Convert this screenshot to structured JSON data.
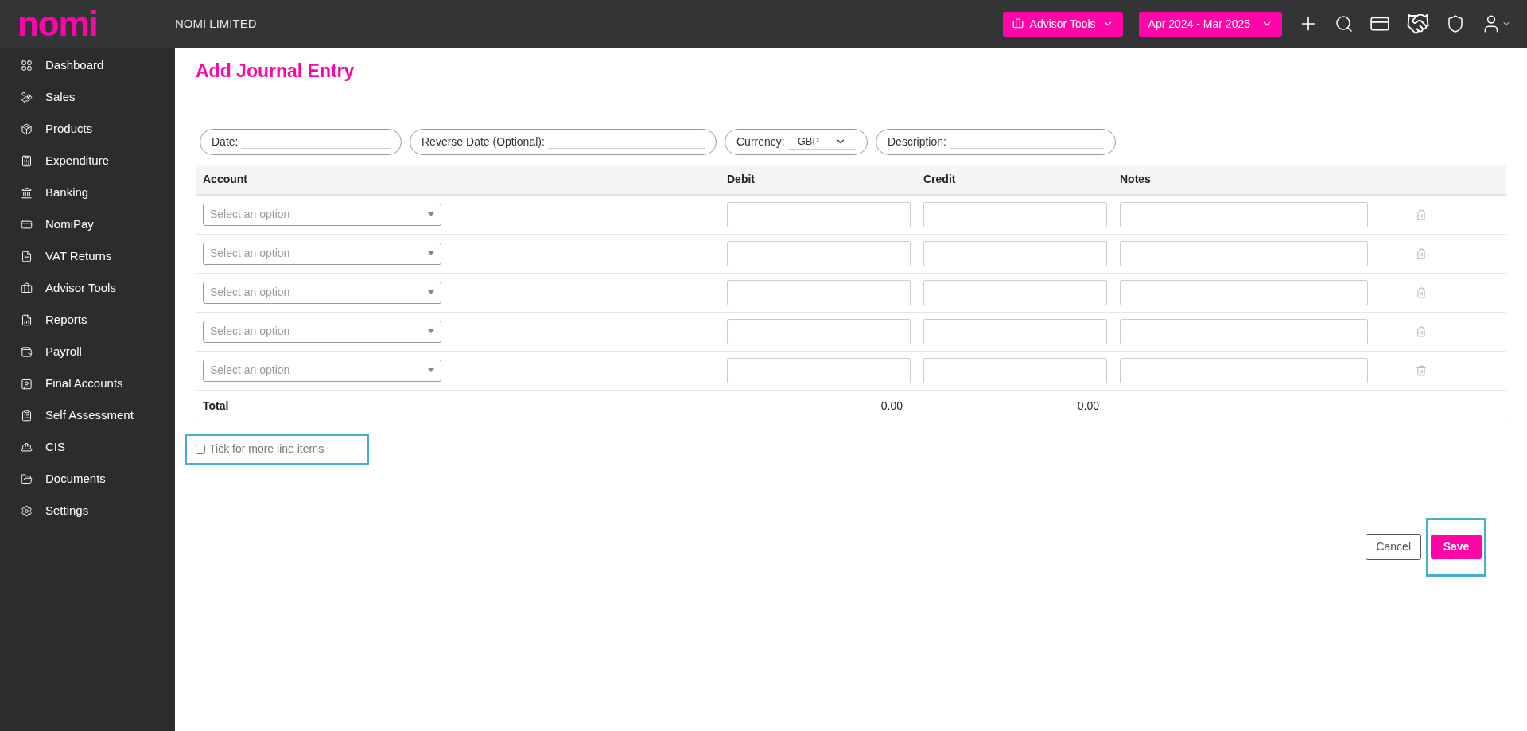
{
  "logo": "nomi",
  "company": "NOMI LIMITED",
  "topbar": {
    "advisor_button": "Advisor Tools",
    "period": "Apr 2024 - Mar 2025"
  },
  "sidebar": {
    "items": [
      {
        "label": "Dashboard"
      },
      {
        "label": "Sales"
      },
      {
        "label": "Products"
      },
      {
        "label": "Expenditure"
      },
      {
        "label": "Banking"
      },
      {
        "label": "NomiPay"
      },
      {
        "label": "VAT Returns"
      },
      {
        "label": "Advisor Tools"
      },
      {
        "label": "Reports"
      },
      {
        "label": "Payroll"
      },
      {
        "label": "Final Accounts"
      },
      {
        "label": "Self Assessment"
      },
      {
        "label": "CIS"
      },
      {
        "label": "Documents"
      },
      {
        "label": "Settings"
      }
    ]
  },
  "page_title": "Add Journal Entry",
  "fields": [
    {
      "kind": "text",
      "label": "Date:"
    },
    {
      "kind": "text",
      "label": "Reverse Date (Optional):"
    },
    {
      "kind": "select",
      "label": "Currency:",
      "value": "GBP"
    },
    {
      "kind": "text",
      "label": "Description:"
    }
  ],
  "table": {
    "columns": [
      "Account",
      "Debit",
      "Credit",
      "Notes"
    ],
    "rows": [
      {
        "account_placeholder": "Select an option"
      },
      {
        "account_placeholder": "Select an option"
      },
      {
        "account_placeholder": "Select an option"
      },
      {
        "account_placeholder": "Select an option"
      },
      {
        "account_placeholder": "Select an option"
      }
    ],
    "total": {
      "label": "Total",
      "debit": "0.00",
      "credit": "0.00"
    }
  },
  "more_items": {
    "label": "Tick for more line items",
    "checked": false
  },
  "buttons": {
    "cancel": "Cancel",
    "save": "Save"
  }
}
